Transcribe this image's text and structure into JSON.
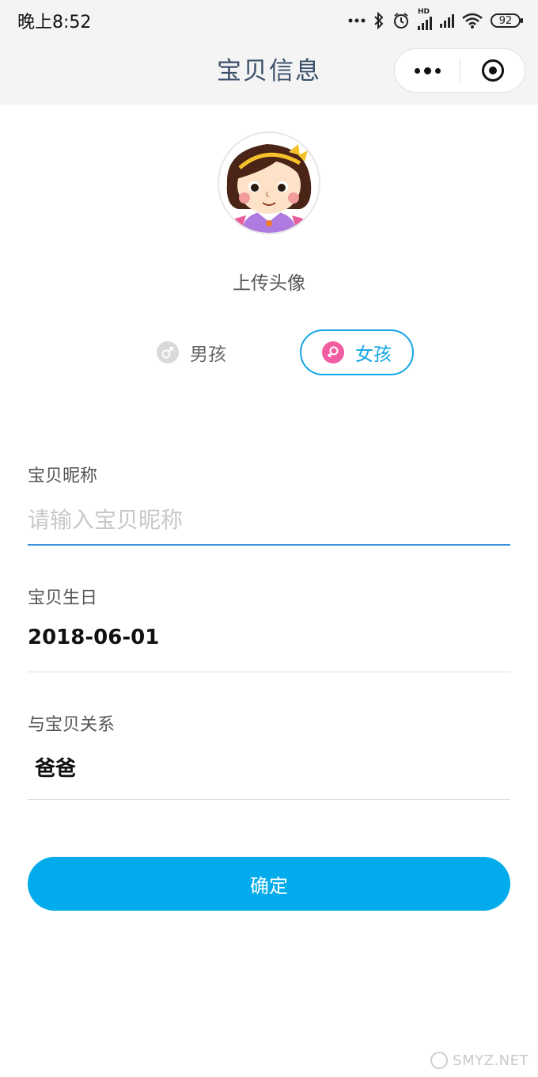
{
  "status_bar": {
    "time": "晚上8:52",
    "icons": [
      "more-dots-icon",
      "bluetooth-icon",
      "alarm-icon",
      "hd-signal-icon",
      "signal-icon",
      "wifi-icon",
      "battery-icon"
    ],
    "hd_label": "HD",
    "battery": "92"
  },
  "nav": {
    "title": "宝贝信息",
    "more_icon": "more-dots-icon",
    "close_icon": "target-icon"
  },
  "avatar": {
    "upload_label": "上传头像"
  },
  "gender": {
    "boy_label": "男孩",
    "girl_label": "女孩",
    "selected": "girl",
    "boy_icon": "male-icon",
    "girl_icon": "female-icon"
  },
  "form": {
    "nickname_label": "宝贝昵称",
    "nickname_placeholder": "请输入宝贝昵称",
    "nickname_value": "",
    "birthday_label": "宝贝生日",
    "birthday_value": "2018-06-01",
    "relation_label": "与宝贝关系",
    "relation_value": "爸爸"
  },
  "confirm_label": "确定",
  "watermark": "SMYZ.NET",
  "colors": {
    "accent": "#02abeb",
    "selected_border": "#12a5e6",
    "girl_icon": "#f25ca0",
    "nav_bg": "#f4f4f4",
    "title": "#3a4f6a"
  }
}
